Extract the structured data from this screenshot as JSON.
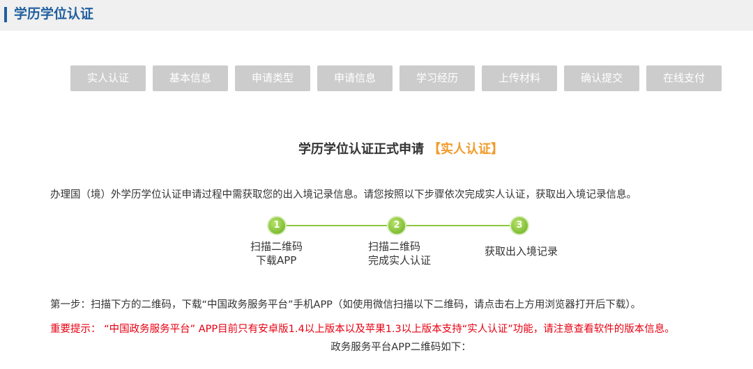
{
  "header": {
    "title": "学历学位认证"
  },
  "steps": [
    {
      "label": "实人认证"
    },
    {
      "label": "基本信息"
    },
    {
      "label": "申请类型"
    },
    {
      "label": "申请信息"
    },
    {
      "label": "学习经历"
    },
    {
      "label": "上传材料"
    },
    {
      "label": "确认提交"
    },
    {
      "label": "在线支付"
    }
  ],
  "main": {
    "title": "学历学位认证正式申请",
    "title_highlight": "【实人认证】",
    "intro": "办理国（境）外学历学位认证申请过程中需获取您的出入境记录信息。请您按照以下步骤依次完成实人认证，获取出入境记录信息。"
  },
  "progress": {
    "steps": [
      {
        "number": "1",
        "line1": "扫描二维码",
        "line2": "下载APP"
      },
      {
        "number": "2",
        "line1": "扫描二维码",
        "line2": "完成实人认证"
      },
      {
        "number": "3",
        "line1": "获取出入境记录",
        "line2": ""
      }
    ]
  },
  "instructions": {
    "step1": "第一步：扫描下方的二维码，下载“中国政务服务平台”手机APP（如使用微信扫描以下二维码，请点击右上方用浏览器打开后下载）。",
    "important": "重要提示：   “中国政务服务平台”  APP目前只有安卓版1.4以上版本以及苹果1.3以上版本支持“实人认证”功能，请注意查看软件的版本信息。",
    "qr_caption": "政务服务平台APP二维码如下："
  },
  "colors": {
    "header_accent": "#1f5f9e",
    "tab_inactive": "#cccccc",
    "highlight_orange": "#f29b2b",
    "progress_green": "#8cc63f",
    "warning_red": "#e60012"
  }
}
